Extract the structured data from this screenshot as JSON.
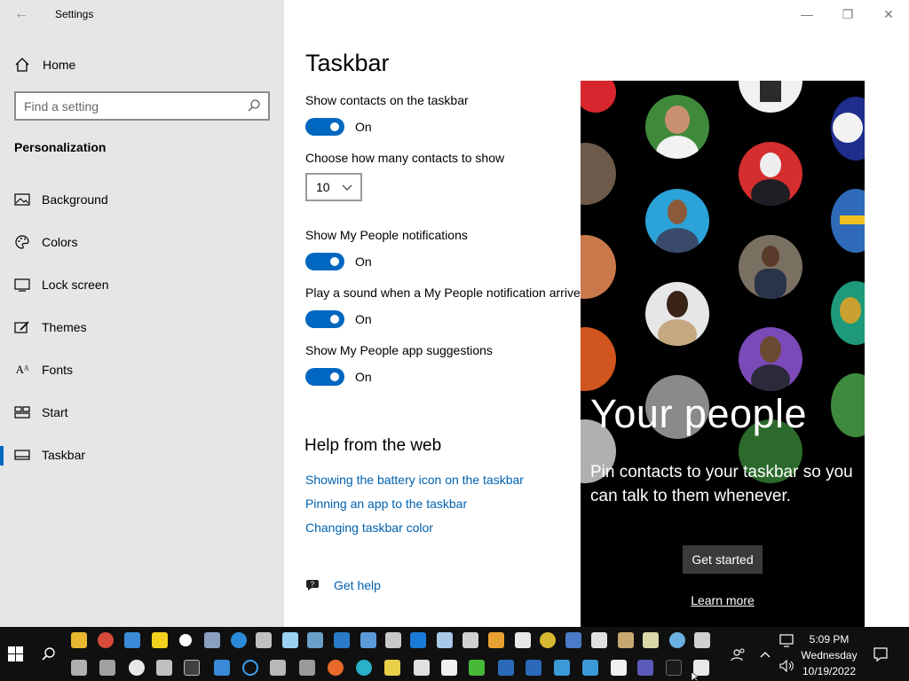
{
  "window": {
    "title": "Settings",
    "back_glyph": "←",
    "minimize_glyph": "—",
    "restore_glyph": "❐",
    "close_glyph": "✕"
  },
  "sidebar": {
    "home_label": "Home",
    "search_placeholder": "Find a setting",
    "section_heading": "Personalization",
    "items": [
      {
        "label": "Background",
        "icon": "picture-icon"
      },
      {
        "label": "Colors",
        "icon": "palette-icon"
      },
      {
        "label": "Lock screen",
        "icon": "lock-screen-icon"
      },
      {
        "label": "Themes",
        "icon": "brush-icon"
      },
      {
        "label": "Fonts",
        "icon": "font-icon"
      },
      {
        "label": "Start",
        "icon": "start-grid-icon"
      },
      {
        "label": "Taskbar",
        "icon": "taskbar-icon",
        "active": true
      }
    ]
  },
  "main": {
    "title": "Taskbar",
    "show_contacts_label": "Show contacts on the taskbar",
    "show_contacts_state": "On",
    "contacts_count_label": "Choose how many contacts to show",
    "contacts_count_value": "10",
    "notifications_label": "Show My People notifications",
    "notifications_state": "On",
    "sound_label": "Play a sound when a My People notification arrives",
    "sound_state": "On",
    "suggestions_label": "Show My People app suggestions",
    "suggestions_state": "On",
    "help_heading": "Help from the web",
    "help_links": [
      "Showing the battery icon on the taskbar",
      "Pinning an app to the taskbar",
      "Changing taskbar color"
    ],
    "get_help": "Get help"
  },
  "promo": {
    "title": "Your people",
    "body": "Pin contacts to your taskbar so you can talk to them whenever.",
    "get_started": "Get started",
    "learn_more": "Learn more"
  },
  "taskbar": {
    "time": "5:09 PM",
    "day": "Wednesday",
    "date": "10/19/2022"
  },
  "colors": {
    "accent": "#0067c0",
    "link": "#0061b0",
    "sidebar_bg": "#e6e6e6",
    "promo_bg": "#000000",
    "taskbar_bg": "#101010"
  }
}
